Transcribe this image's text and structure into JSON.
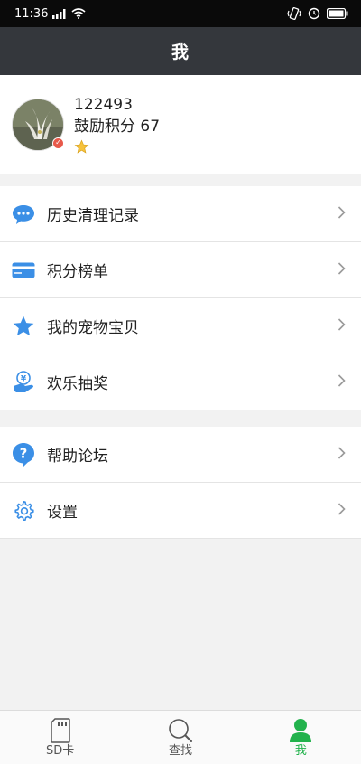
{
  "status_bar": {
    "time": "11:36",
    "signal_icon": "signal-icon",
    "wifi_icon": "wifi-icon",
    "battery_icon": "battery-icon"
  },
  "header": {
    "title": "我"
  },
  "profile": {
    "user_id": "122493",
    "points_label": "鼓励积分 67"
  },
  "menu_group_1": [
    {
      "label": "历史清理记录",
      "icon": "chat-bubble-icon",
      "color": "#3b8fe6"
    },
    {
      "label": "积分榜单",
      "icon": "card-icon",
      "color": "#3b8fe6"
    },
    {
      "label": "我的宠物宝贝",
      "icon": "star-icon",
      "color": "#3b8fe6"
    },
    {
      "label": "欢乐抽奖",
      "icon": "hand-coin-icon",
      "color": "#3b8fe6"
    }
  ],
  "menu_group_2": [
    {
      "label": "帮助论坛",
      "icon": "help-icon",
      "color": "#3b8fe6"
    },
    {
      "label": "设置",
      "icon": "gear-icon",
      "color": "#3b8fe6"
    }
  ],
  "bottom_nav": [
    {
      "label": "SD卡",
      "icon": "sd-card-icon",
      "active": false
    },
    {
      "label": "查找",
      "icon": "search-icon",
      "active": false
    },
    {
      "label": "我",
      "icon": "person-icon",
      "active": true
    }
  ],
  "colors": {
    "accent_blue": "#3b8fe6",
    "active_green": "#22b24c",
    "title_bar": "#34373c"
  }
}
